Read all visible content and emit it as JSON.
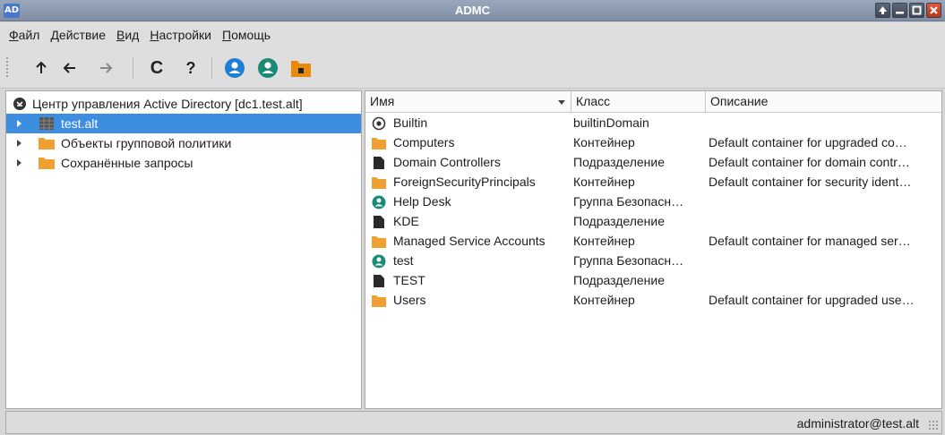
{
  "window": {
    "title": "ADMC",
    "app_icon_text": "AD"
  },
  "menu": [
    {
      "u": "Ф",
      "rest": "айл"
    },
    {
      "u": "Д",
      "rest": "ействие"
    },
    {
      "u": "В",
      "rest": "ид"
    },
    {
      "u": "Н",
      "rest": "астройки"
    },
    {
      "u": "П",
      "rest": "омощь"
    }
  ],
  "toolbar": {
    "up_icon": "arrow-up-icon",
    "back_icon": "arrow-left-icon",
    "forward_icon": "arrow-right-icon",
    "refresh_glyph": "C",
    "help_glyph": "?",
    "accent": "#1e7fd6",
    "green": "#1a8a78",
    "orange": "#e8890c"
  },
  "tree": {
    "root": "Центр управления Active Directory [dc1.test.alt]",
    "items": [
      {
        "label": "test.alt",
        "icon": "domain-icon",
        "selected": true
      },
      {
        "label": "Объекты групповой политики",
        "icon": "folder-icon",
        "selected": false
      },
      {
        "label": "Сохранённые запросы",
        "icon": "folder-icon",
        "selected": false
      }
    ]
  },
  "table": {
    "columns": [
      "Имя",
      "Класс",
      "Описание"
    ],
    "rows": [
      {
        "name": "Builtin",
        "class": "builtinDomain",
        "desc": "",
        "icon": "builtin-icon"
      },
      {
        "name": "Computers",
        "class": "Контейнер",
        "desc": "Default container for upgraded co…",
        "icon": "folder-icon"
      },
      {
        "name": "Domain Controllers",
        "class": "Подразделение",
        "desc": "Default container for domain contr…",
        "icon": "ou-icon"
      },
      {
        "name": "ForeignSecurityPrincipals",
        "class": "Контейнер",
        "desc": "Default container for security ident…",
        "icon": "folder-icon"
      },
      {
        "name": "Help Desk",
        "class": "Группа Безопасн…",
        "desc": "",
        "icon": "group-icon"
      },
      {
        "name": "KDE",
        "class": "Подразделение",
        "desc": "",
        "icon": "ou-icon"
      },
      {
        "name": "Managed Service Accounts",
        "class": "Контейнер",
        "desc": "Default container for managed ser…",
        "icon": "folder-icon"
      },
      {
        "name": "test",
        "class": "Группа Безопасн…",
        "desc": "",
        "icon": "group-icon"
      },
      {
        "name": "TEST",
        "class": "Подразделение",
        "desc": "",
        "icon": "ou-icon"
      },
      {
        "name": "Users",
        "class": "Контейнер",
        "desc": "Default container for upgraded use…",
        "icon": "folder-icon"
      }
    ]
  },
  "status": {
    "user": "administrator@test.alt"
  },
  "colors": {
    "selection": "#3d8ee0",
    "folder": "#f0a030",
    "ou": "#2a2a2a",
    "group": "#1a8a78"
  }
}
